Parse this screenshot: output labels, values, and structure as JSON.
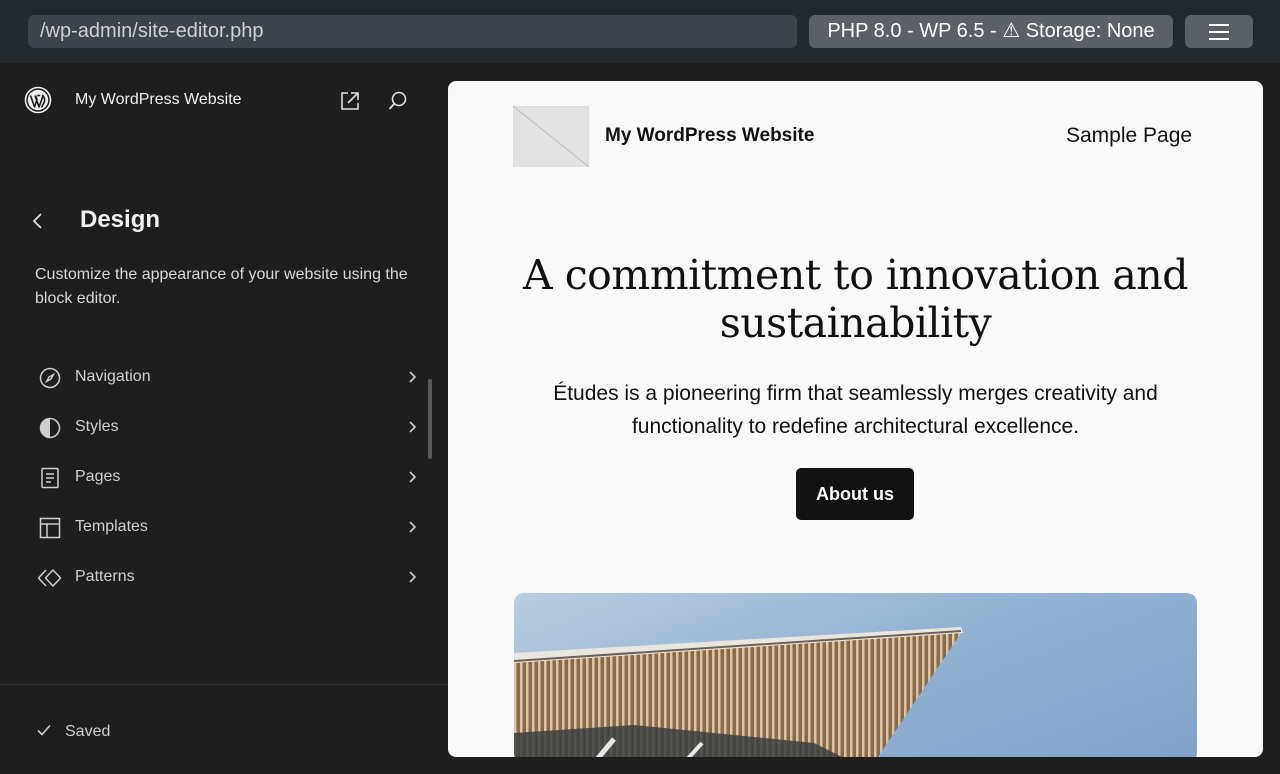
{
  "browser": {
    "url": "/wp-admin/site-editor.php",
    "env_badge": "PHP 8.0 - WP 6.5 - ⚠ Storage: None",
    "menu_icon": "hamburger-icon"
  },
  "sidebar": {
    "site_title": "My WordPress Website",
    "section_title": "Design",
    "section_description": "Customize the appearance of your website using the block editor.",
    "items": [
      {
        "label": "Navigation",
        "icon": "compass-icon"
      },
      {
        "label": "Styles",
        "icon": "half-circle-icon"
      },
      {
        "label": "Pages",
        "icon": "page-icon"
      },
      {
        "label": "Templates",
        "icon": "layout-icon"
      },
      {
        "label": "Patterns",
        "icon": "diamond-icon"
      }
    ],
    "status": "Saved"
  },
  "canvas": {
    "site_title": "My WordPress Website",
    "nav_link": "Sample Page",
    "hero_title": "A commitment to innovation and sustainability",
    "hero_text": "Études is a pioneering firm that seamlessly merges creativity and functionality to redefine architectural excellence.",
    "cta_label": "About us"
  },
  "colors": {
    "sidebar_bg": "#1e1e1e",
    "topbar_bg": "#23282d",
    "canvas_bg": "#f9f9f9",
    "button_bg": "#111111"
  }
}
